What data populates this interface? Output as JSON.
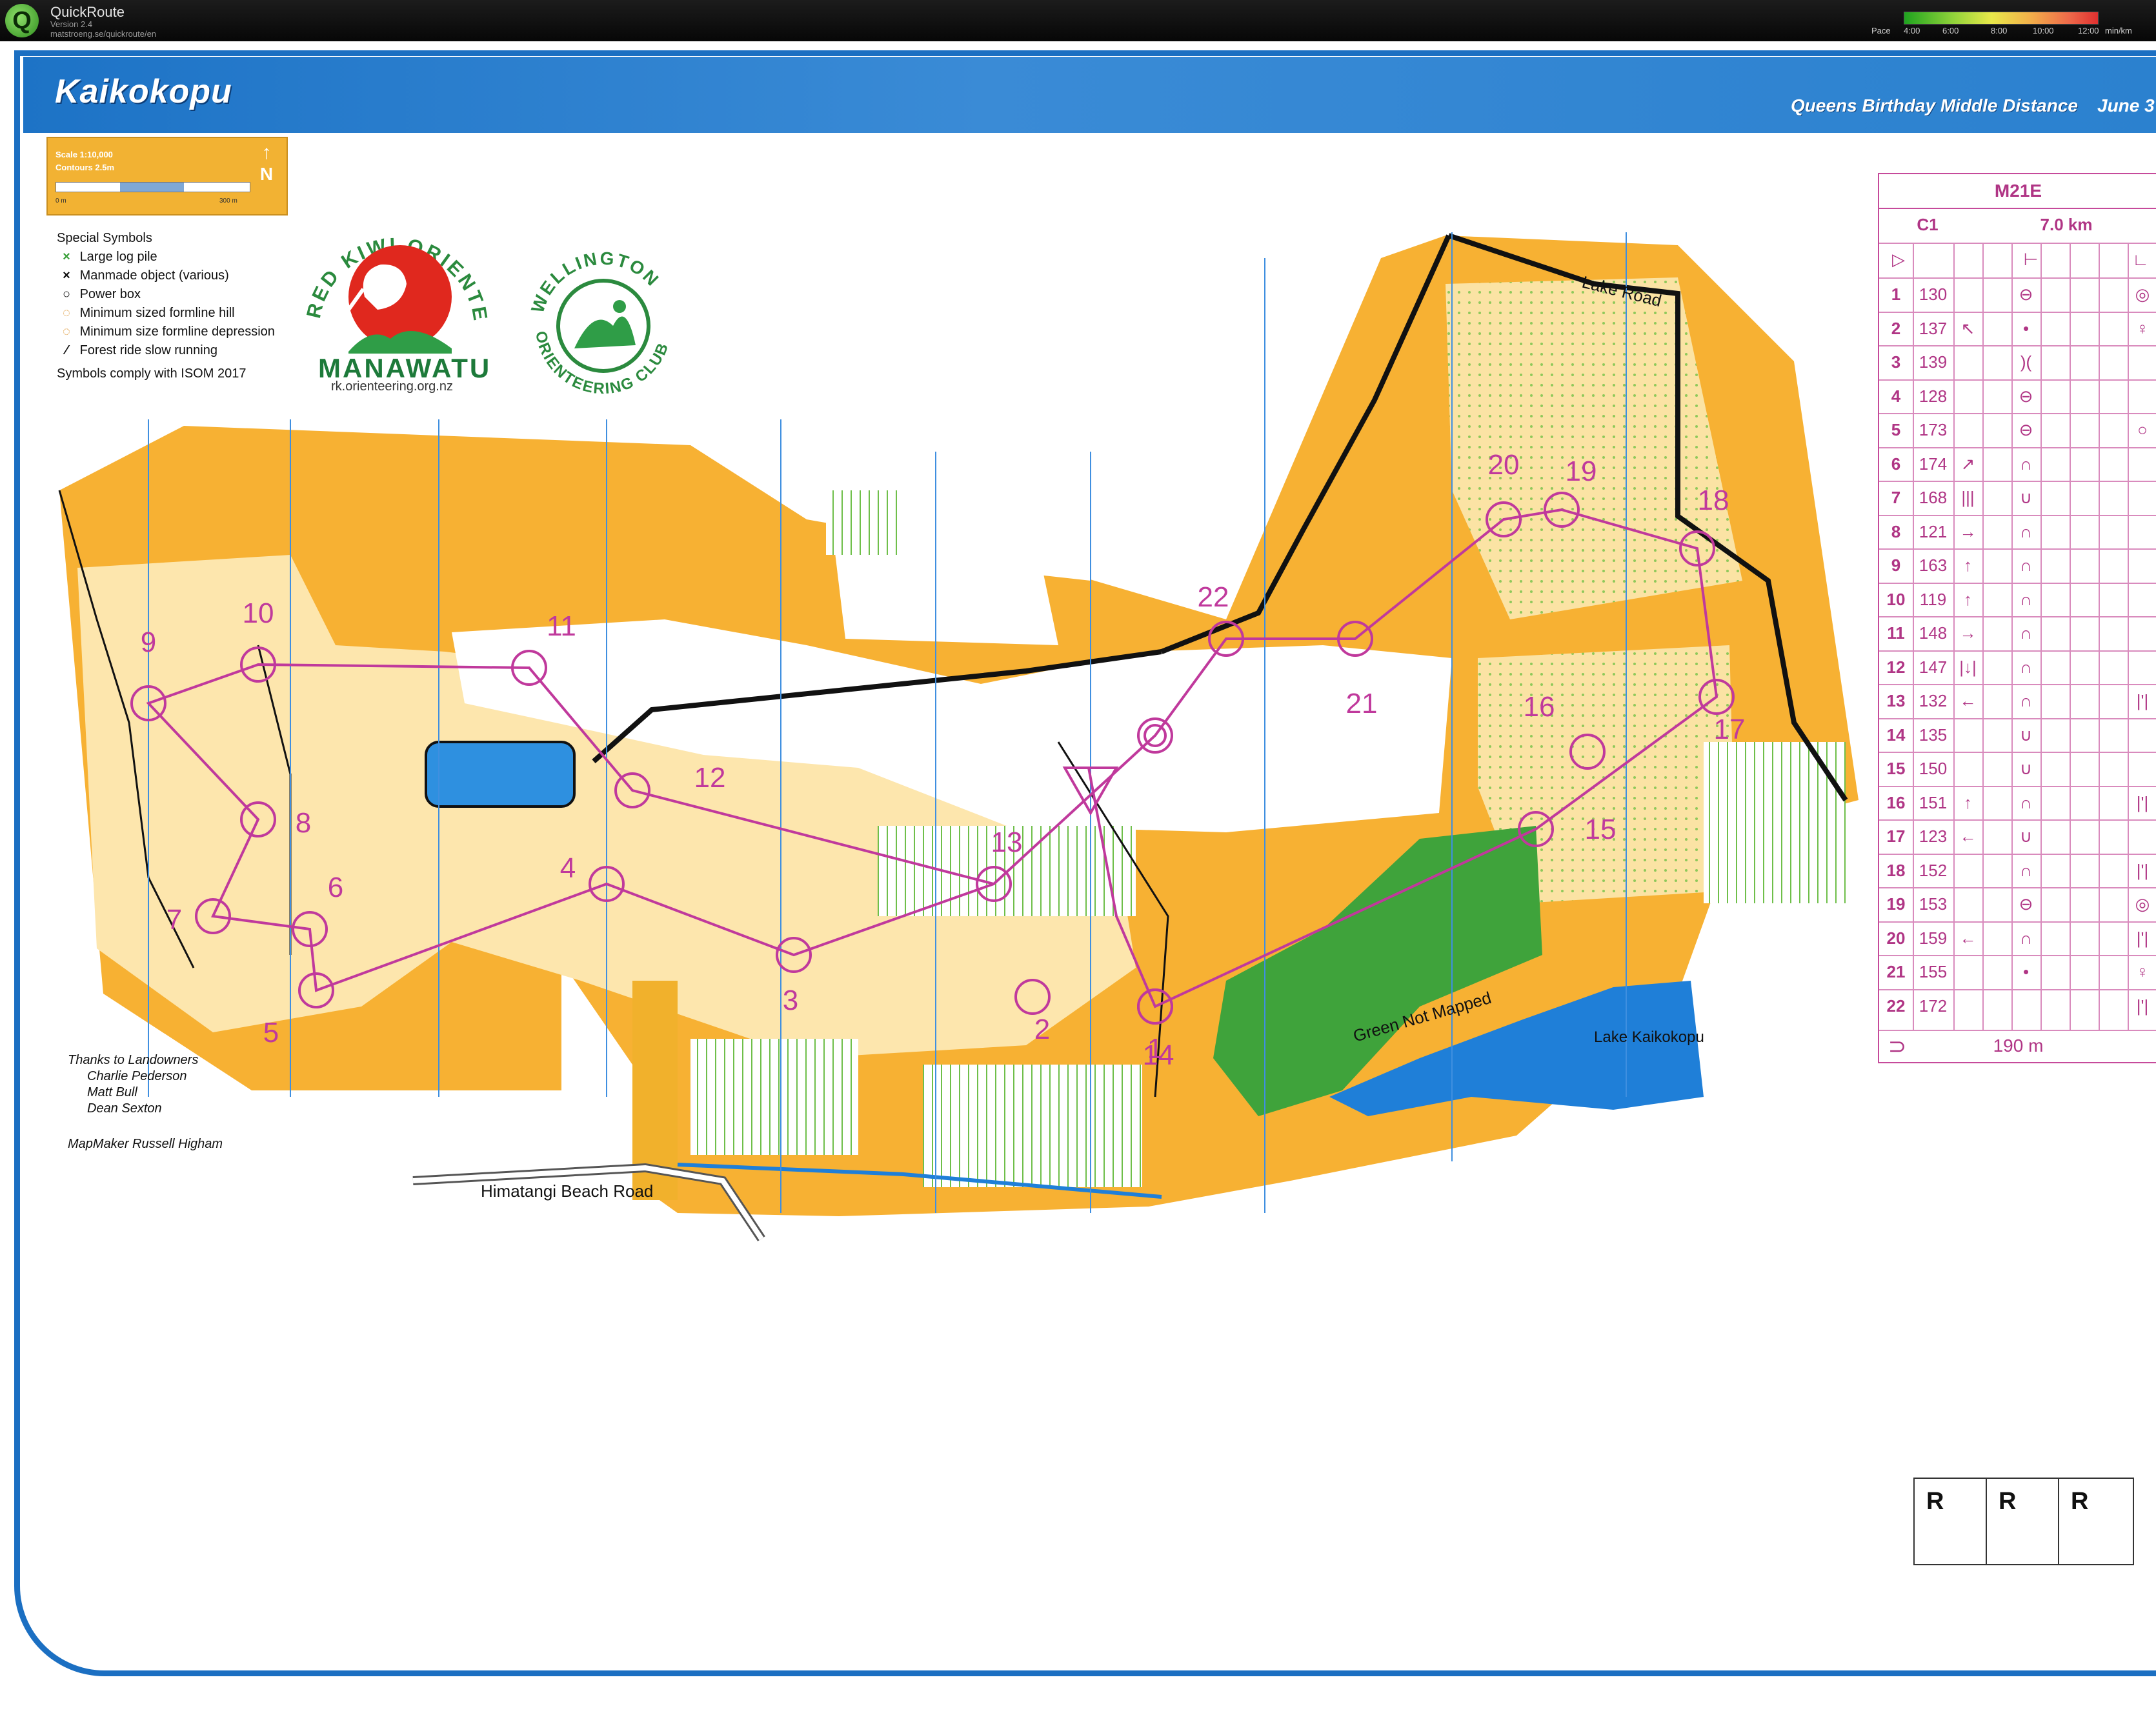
{
  "app": {
    "name": "QuickRoute",
    "version": "Version 2.4",
    "url": "matstroeng.se/quickroute/en",
    "pace_label": "Pace",
    "pace_ticks": [
      "4:00",
      "6:00",
      "8:00",
      "10:00",
      "12:00"
    ],
    "pace_unit": "min/km",
    "logo_letter": "Q"
  },
  "map": {
    "title": "Kaikokopu",
    "event_name": "Queens Birthday  Middle Distance",
    "event_date": "June 3",
    "scale": "Scale 1:10,000",
    "contours": "Contours 2.5m",
    "scale_zero": "0 m",
    "scale_end": "300 m",
    "north": "N"
  },
  "legend": {
    "title": "Special Symbols",
    "items": [
      {
        "symbol": "×",
        "label": "Large log pile",
        "color": "#3aa03a"
      },
      {
        "symbol": "×",
        "label": "Manmade object (various)",
        "color": "#111111"
      },
      {
        "symbol": "○",
        "label": "Power box",
        "color": "#111111"
      },
      {
        "symbol": "◌",
        "label": "Minimum sized formline hill",
        "color": "#d98a1e"
      },
      {
        "symbol": "◌",
        "label": "Minimum size formline depression",
        "color": "#d98a1e"
      },
      {
        "symbol": "⁄",
        "label": "Forest ride slow running",
        "color": "#111111"
      }
    ],
    "comply": "Symbols comply with ISOM 2017"
  },
  "clubs": {
    "club1_arc": "RED KIWI ORIENTEERS",
    "club1_name": "MANAWATU",
    "club1_url": "rk.orienteering.org.nz",
    "club2_top": "WELLINGTON",
    "club2_bottom": "ORIENTEERING CLUB"
  },
  "credits": {
    "heading": "Thanks to Landowners",
    "names": [
      "Charlie Pederson",
      "Matt Bull",
      "Dean Sexton"
    ],
    "mapmaker": "MapMaker Russell Higham"
  },
  "map_labels": {
    "lake_road": "Lake Road",
    "beach_road": "Himatangi Beach Road",
    "green": "Green Not Mapped",
    "lake": "Lake Kaikokopu"
  },
  "controls_on_map": [
    "1",
    "2",
    "3",
    "4",
    "5",
    "6",
    "7",
    "8",
    "9",
    "10",
    "11",
    "12",
    "13",
    "14",
    "15",
    "16",
    "17",
    "18",
    "19",
    "20",
    "21",
    "22"
  ],
  "description_sheet": {
    "class": "M21E",
    "course": "C1",
    "length": "7.0 km",
    "rows": [
      {
        "n": "1",
        "code": "130",
        "dir": "",
        "feature": "⊖",
        "extra": "◎"
      },
      {
        "n": "2",
        "code": "137",
        "dir": "↖",
        "feature": "•",
        "extra": "♀"
      },
      {
        "n": "3",
        "code": "139",
        "dir": "",
        "feature": ")(",
        "extra": ""
      },
      {
        "n": "4",
        "code": "128",
        "dir": "",
        "feature": "⊖",
        "extra": ""
      },
      {
        "n": "5",
        "code": "173",
        "dir": "",
        "feature": "⊖",
        "extra": "○"
      },
      {
        "n": "6",
        "code": "174",
        "dir": "↗",
        "feature": "∩",
        "extra": ""
      },
      {
        "n": "7",
        "code": "168",
        "dir": "|||",
        "feature": "∪",
        "extra": ""
      },
      {
        "n": "8",
        "code": "121",
        "dir": "→",
        "feature": "∩",
        "extra": ""
      },
      {
        "n": "9",
        "code": "163",
        "dir": "↑",
        "feature": "∩",
        "extra": ""
      },
      {
        "n": "10",
        "code": "119",
        "dir": "↑",
        "feature": "∩",
        "extra": ""
      },
      {
        "n": "11",
        "code": "148",
        "dir": "→",
        "feature": "∩",
        "extra": ""
      },
      {
        "n": "12",
        "code": "147",
        "dir": "|↓|",
        "feature": "∩",
        "extra": ""
      },
      {
        "n": "13",
        "code": "132",
        "dir": "←",
        "feature": "∩",
        "extra": "|'|"
      },
      {
        "n": "14",
        "code": "135",
        "dir": "",
        "feature": "∪",
        "extra": ""
      },
      {
        "n": "15",
        "code": "150",
        "dir": "",
        "feature": "∪",
        "extra": ""
      },
      {
        "n": "16",
        "code": "151",
        "dir": "↑",
        "feature": "∩",
        "extra": "|'|"
      },
      {
        "n": "17",
        "code": "123",
        "dir": "←",
        "feature": "∪",
        "extra": ""
      },
      {
        "n": "18",
        "code": "152",
        "dir": "",
        "feature": "∩",
        "extra": "|'|"
      },
      {
        "n": "19",
        "code": "153",
        "dir": "",
        "feature": "⊖",
        "extra": "◎"
      },
      {
        "n": "20",
        "code": "159",
        "dir": "←",
        "feature": "∩",
        "extra": "|'|"
      },
      {
        "n": "21",
        "code": "155",
        "dir": "",
        "feature": "•",
        "extra": "♀"
      },
      {
        "n": "22",
        "code": "172",
        "dir": "",
        "feature": "",
        "extra": "|'|"
      }
    ],
    "finish": "190 m"
  },
  "rboxes": [
    "R",
    "R",
    "R"
  ],
  "colors": {
    "open": "#f7b133",
    "rough": "#fbe09a",
    "green": "#3fa33b",
    "water": "#1f7fd8",
    "course": "#c0399c",
    "frame": "#1b6fc2"
  }
}
